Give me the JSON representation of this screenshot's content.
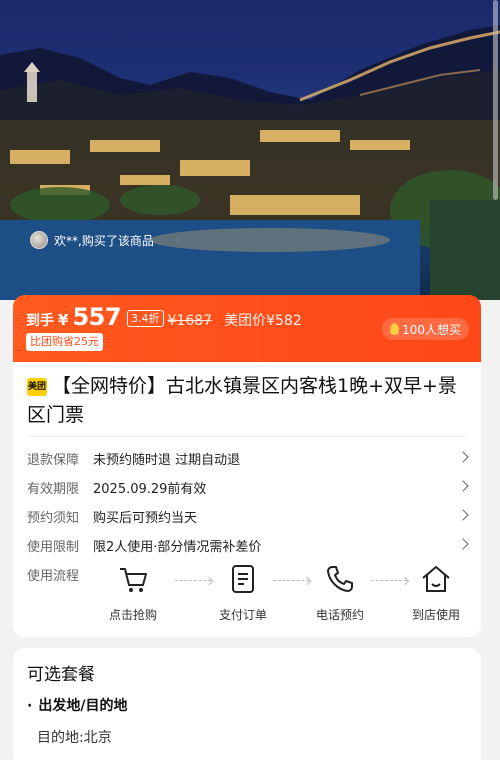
{
  "hero": {
    "buyer_notice": "欢**,购买了该商品"
  },
  "price": {
    "prefix": "到手",
    "currency": "¥",
    "amount": "557",
    "discount": "3.4折",
    "original": "¥1687",
    "meituan_label": "美团价¥582",
    "group_saving": "比团购省25元",
    "wants": "100人想买"
  },
  "product": {
    "brand_logo": "美团",
    "title": "【全网特价】古北水镇景区内客栈1晚+双早+景区门票"
  },
  "details": [
    {
      "label": "退款保障",
      "value": "未预约随时退 过期自动退"
    },
    {
      "label": "有效期限",
      "value": "2025.09.29前有效"
    },
    {
      "label": "预约须知",
      "value": "购买后可预约当天"
    },
    {
      "label": "使用限制",
      "value": "限2人使用·部分情况需补差价"
    }
  ],
  "flow": {
    "label": "使用流程",
    "steps": [
      {
        "icon": "cart-icon",
        "label": "点击抢购"
      },
      {
        "icon": "order-icon",
        "label": "支付订单"
      },
      {
        "icon": "phone-icon",
        "label": "电话预约"
      },
      {
        "icon": "home-icon",
        "label": "到店使用"
      }
    ]
  },
  "packages": {
    "title": "可选套餐",
    "section": "出发地/目的地",
    "destination": "目的地:北京"
  },
  "colors": {
    "accent": "#ff4d1a",
    "brand_yellow": "#ffd000"
  }
}
